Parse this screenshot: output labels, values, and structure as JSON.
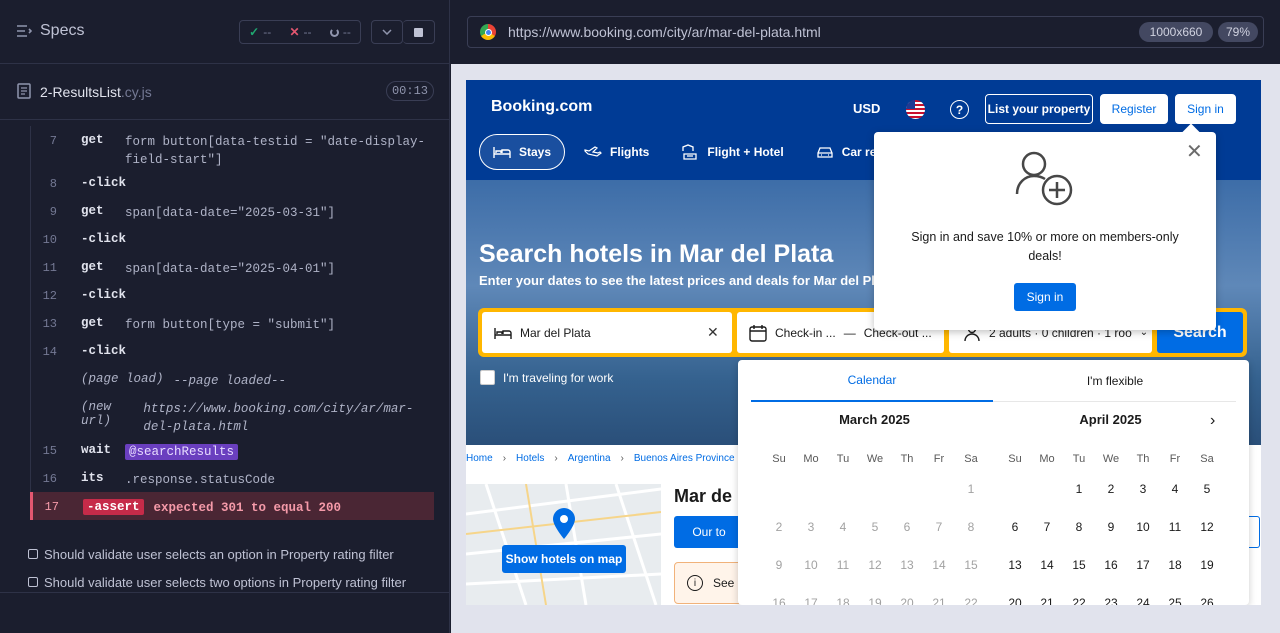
{
  "cypress": {
    "specs_label": "Specs",
    "stats": {
      "passed": "--",
      "failed": "--",
      "pending": "--"
    },
    "file_name": "2-ResultsList",
    "file_ext": ".cy.js",
    "timer": "00:13",
    "commands": [
      {
        "num": "7",
        "name": "get",
        "msg": "form button[data-testid = \"date-display-field-start\"]",
        "kind": "cmd"
      },
      {
        "num": "8",
        "name": "-click",
        "msg": "",
        "kind": "child"
      },
      {
        "num": "9",
        "name": "get",
        "msg": "span[data-date=\"2025-03-31\"]",
        "kind": "cmd"
      },
      {
        "num": "10",
        "name": "-click",
        "msg": "",
        "kind": "child"
      },
      {
        "num": "11",
        "name": "get",
        "msg": "span[data-date=\"2025-04-01\"]",
        "kind": "cmd"
      },
      {
        "num": "12",
        "name": "-click",
        "msg": "",
        "kind": "child"
      },
      {
        "num": "13",
        "name": "get",
        "msg": "form button[type = \"submit\"]",
        "kind": "cmd"
      },
      {
        "num": "14",
        "name": "-click",
        "msg": "",
        "kind": "child"
      },
      {
        "num": "",
        "name": "(page load)",
        "msg": "--page loaded--",
        "kind": "info"
      },
      {
        "num": "",
        "name": "(new url)",
        "msg": "https://www.booking.com/city/ar/mar-del-plata.html",
        "kind": "info"
      },
      {
        "num": "15",
        "name": "wait",
        "msg": "@searchResults",
        "kind": "alias"
      },
      {
        "num": "16",
        "name": "its",
        "msg": ".response.statusCode",
        "kind": "cmd"
      },
      {
        "num": "17",
        "name": "-assert",
        "msg": "expected 301 to equal 200",
        "kind": "fail"
      }
    ],
    "tests": [
      "Should validate user selects an option in Property rating filter",
      "Should validate user selects two options in Property rating filter"
    ]
  },
  "browser": {
    "url": "https://www.booking.com/city/ar/mar-del-plata.html",
    "viewport": "1000x660",
    "zoom": "79%"
  },
  "booking": {
    "logo": "Booking.com",
    "currency": "USD",
    "help": "?",
    "list_property": "List your property",
    "register": "Register",
    "sign_in": "Sign in",
    "nav": [
      "Stays",
      "Flights",
      "Flight + Hotel",
      "Car rentals"
    ],
    "hero_title": "Search hotels in Mar del Plata",
    "hero_sub": "Enter your dates to see the latest prices and deals for Mar del Pla",
    "destination": "Mar del Plata",
    "check_in": "Check-in ...",
    "dash": "—",
    "check_out": "Check-out ...",
    "guests": "2 adults · 0 children · 1 roo",
    "search": "Search",
    "work_travel": "I'm traveling for work",
    "breadcrumbs": [
      "Home",
      "Hotels",
      "Argentina",
      "Buenos Aires Province"
    ],
    "show_map": "Show hotels on map",
    "page_title": "Mar de",
    "our_top": "Our to",
    "see": "See",
    "popover_text": "Sign in and save 10% or more on members-only deals!",
    "popover_btn": "Sign in",
    "calendar_tab": "Calendar",
    "flexible_tab": "I'm flexible",
    "weekdays": [
      "Su",
      "Mo",
      "Tu",
      "We",
      "Th",
      "Fr",
      "Sa"
    ],
    "march": {
      "title": "March 2025",
      "offset": 6,
      "days": [
        "1",
        "2",
        "3",
        "4",
        "5",
        "6",
        "7",
        "8",
        "9",
        "10",
        "11",
        "12",
        "13",
        "14",
        "15",
        "16",
        "17",
        "18",
        "19",
        "20",
        "21",
        "22"
      ]
    },
    "april": {
      "title": "April 2025",
      "offset": 2,
      "days": [
        "1",
        "2",
        "3",
        "4",
        "5",
        "6",
        "7",
        "8",
        "9",
        "10",
        "11",
        "12",
        "13",
        "14",
        "15",
        "16",
        "17",
        "18",
        "19",
        "20",
        "21",
        "22",
        "23",
        "24",
        "25",
        "26"
      ]
    }
  }
}
